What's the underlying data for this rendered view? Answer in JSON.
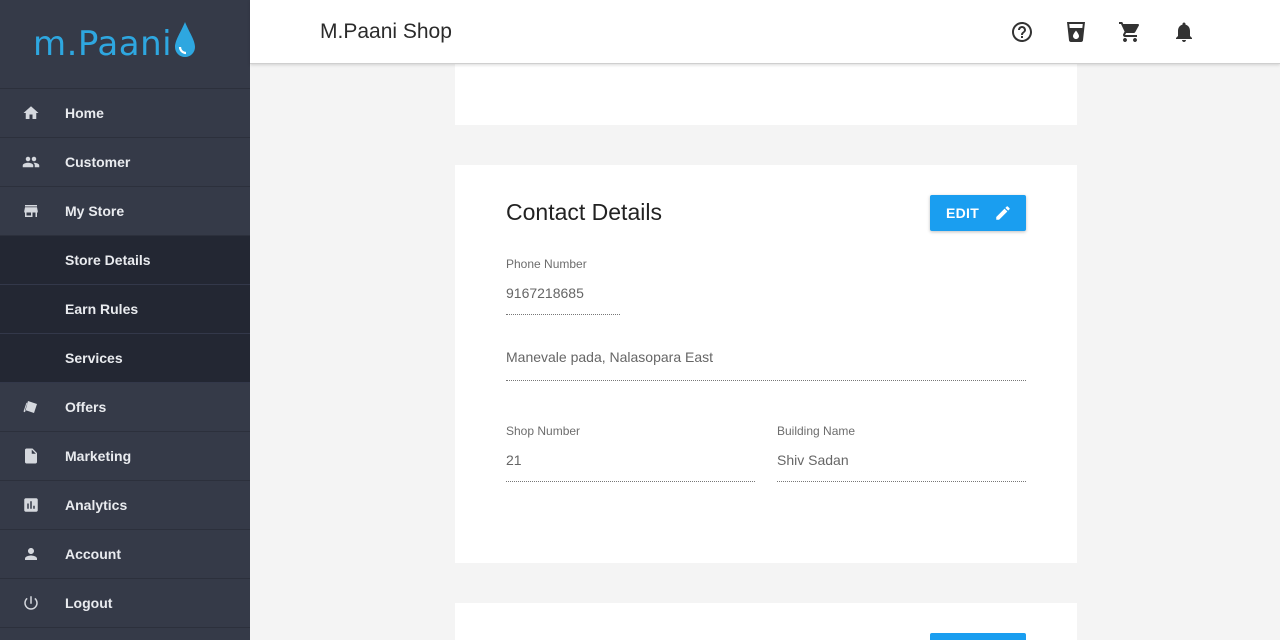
{
  "brand": {
    "logo_text": "m.Paani",
    "accent": "#2ea7e0"
  },
  "sidebar": {
    "items": [
      {
        "label": "Home",
        "icon": "home-icon"
      },
      {
        "label": "Customer",
        "icon": "people-icon"
      },
      {
        "label": "My Store",
        "icon": "store-icon"
      },
      {
        "label": "Store Details",
        "sub": true
      },
      {
        "label": "Earn Rules",
        "sub": true
      },
      {
        "label": "Services",
        "sub": true
      },
      {
        "label": "Offers",
        "icon": "offers-icon"
      },
      {
        "label": "Marketing",
        "icon": "document-icon"
      },
      {
        "label": "Analytics",
        "icon": "analytics-icon"
      },
      {
        "label": "Account",
        "icon": "person-icon"
      },
      {
        "label": "Logout",
        "icon": "power-icon"
      }
    ]
  },
  "header": {
    "title": "M.Paani Shop",
    "icons": [
      "help-icon",
      "cup-icon",
      "cart-icon",
      "bell-icon"
    ]
  },
  "contact": {
    "title": "Contact Details",
    "edit_label": "EDIT",
    "phone_label": "Phone Number",
    "phone_value": "9167218685",
    "address_value": "Manevale pada, Nalasopara East",
    "shop_label": "Shop Number",
    "shop_value": "21",
    "building_label": "Building Name",
    "building_value": "Shiv Sadan"
  }
}
